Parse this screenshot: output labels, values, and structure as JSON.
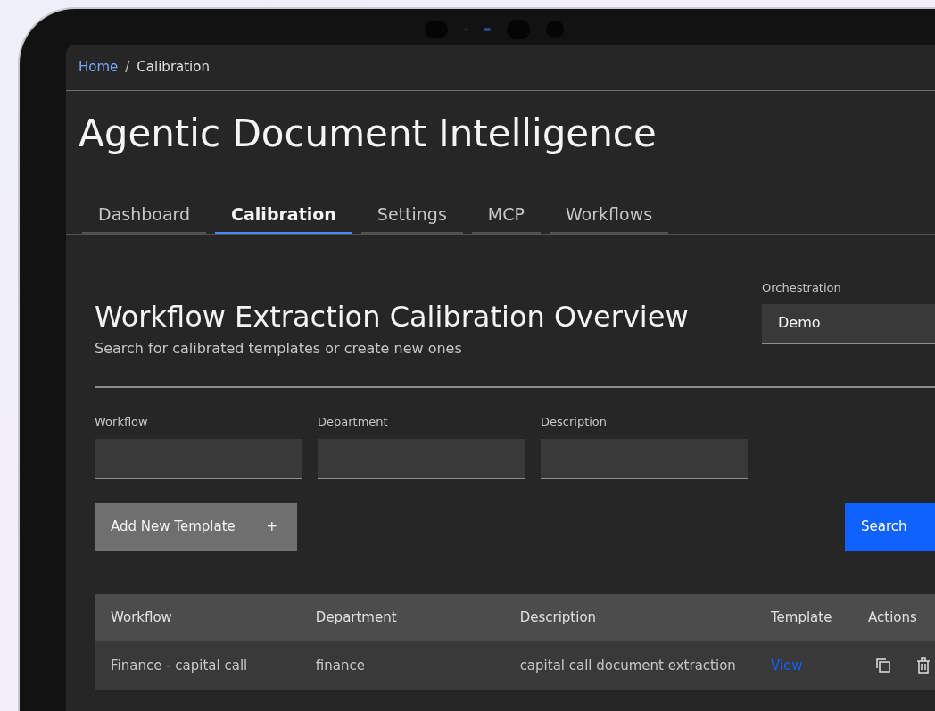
{
  "breadcrumb": [
    {
      "label": "Home",
      "kind": "link"
    },
    {
      "label": "/",
      "kind": "separator"
    },
    {
      "label": "Calibration",
      "kind": "current"
    }
  ],
  "app_title": "Agentic Document Intelligence",
  "tabs": [
    {
      "label": "Dashboard",
      "selected": false
    },
    {
      "label": "Calibration",
      "selected": true
    },
    {
      "label": "Settings",
      "selected": false
    },
    {
      "label": "MCP",
      "selected": false
    },
    {
      "label": "Workflows",
      "selected": false
    }
  ],
  "section": {
    "title": "Workflow Extraction Calibration Overview",
    "subtitle": "Search for calibrated templates or create new ones"
  },
  "orchestration": {
    "label": "Orchestration",
    "value": "Demo"
  },
  "filters": [
    {
      "label": "Workflow"
    },
    {
      "label": "Department"
    },
    {
      "label": "Description"
    }
  ],
  "add_button": {
    "label": "Add New Template",
    "icon": "+"
  },
  "search_button": "Search",
  "table": {
    "columns": [
      "Workflow",
      "Department",
      "Description",
      "Template",
      "Actions"
    ],
    "rows": [
      {
        "workflow": "Finance - capital call",
        "department": "finance",
        "description": "capital call document extraction",
        "template": "View"
      }
    ]
  }
}
